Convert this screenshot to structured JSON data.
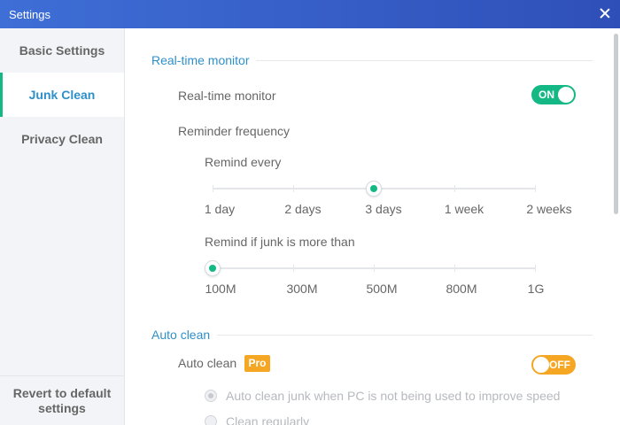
{
  "window": {
    "title": "Settings"
  },
  "sidebar": {
    "items": [
      {
        "label": "Basic Settings"
      },
      {
        "label": "Junk Clean"
      },
      {
        "label": "Privacy Clean"
      }
    ],
    "active_index": 1,
    "revert_label": "Revert to default settings"
  },
  "realtime": {
    "section_title": "Real-time monitor",
    "monitor_label": "Real-time monitor",
    "monitor_toggle": "ON",
    "frequency_label": "Reminder frequency",
    "remind_every": {
      "label": "Remind every",
      "options": [
        "1 day",
        "2 days",
        "3 days",
        "1 week",
        "2 weeks"
      ],
      "selected": "3 days"
    },
    "junk_threshold": {
      "label": "Remind if junk is more than",
      "options": [
        "100M",
        "300M",
        "500M",
        "800M",
        "1G"
      ],
      "selected": "100M"
    }
  },
  "autoclean": {
    "section_title": "Auto clean",
    "label": "Auto clean",
    "badge": "Pro",
    "toggle": "OFF",
    "options": [
      {
        "label": "Auto clean junk when PC is not being used to improve speed",
        "checked": true
      },
      {
        "label": "Clean regularly",
        "checked": false
      }
    ]
  },
  "colors": {
    "accent_green": "#14b884",
    "accent_blue": "#2f8fc9",
    "accent_orange": "#f5a623",
    "titlebar": "#3e6fd6"
  }
}
